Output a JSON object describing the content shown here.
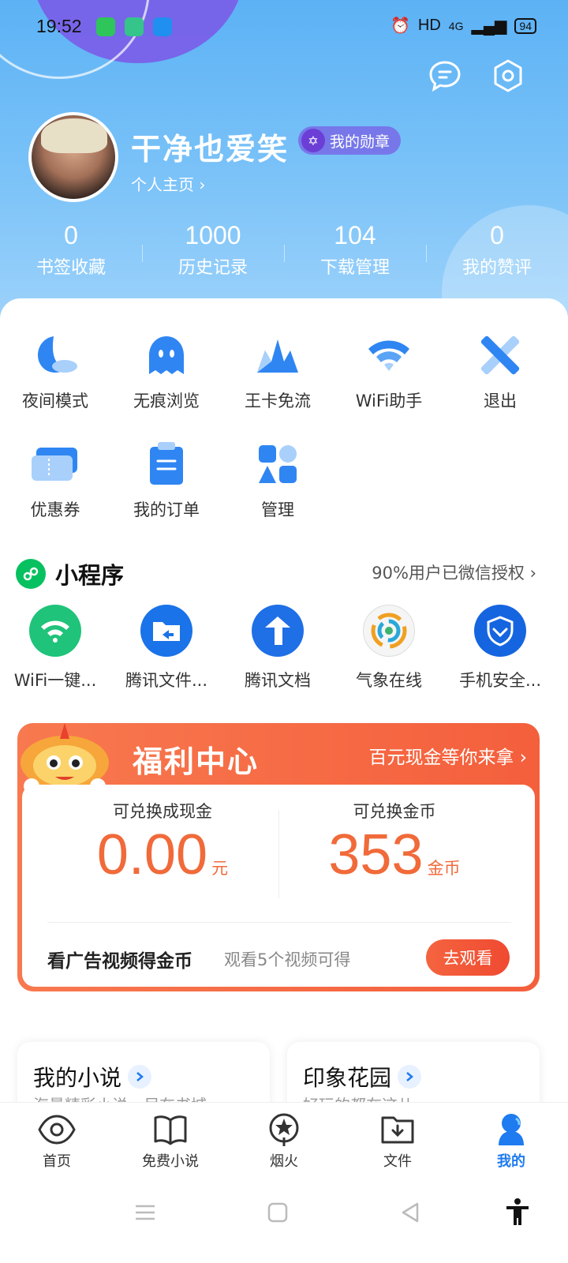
{
  "status_bar": {
    "time": "19:52",
    "network": "HD",
    "signal": "4G",
    "battery": "94"
  },
  "profile": {
    "username": "干净也爱笑",
    "medal_label": "我的勋章",
    "homepage_link": "个人主页 ›"
  },
  "stats": [
    {
      "value": "0",
      "label": "书签收藏"
    },
    {
      "value": "1000",
      "label": "历史记录"
    },
    {
      "value": "104",
      "label": "下载管理"
    },
    {
      "value": "0",
      "label": "我的赞评"
    }
  ],
  "tools": [
    {
      "label": "夜间模式",
      "icon": "moon-icon"
    },
    {
      "label": "无痕浏览",
      "icon": "ghost-icon"
    },
    {
      "label": "王卡免流",
      "icon": "crown-icon"
    },
    {
      "label": "WiFi助手",
      "icon": "wifi-icon"
    },
    {
      "label": "退出",
      "icon": "exit-icon"
    },
    {
      "label": "优惠券",
      "icon": "coupon-icon"
    },
    {
      "label": "我的订单",
      "icon": "order-icon"
    },
    {
      "label": "管理",
      "icon": "manage-icon"
    }
  ],
  "mini_programs": {
    "title": "小程序",
    "link": "90%用户已微信授权 ›",
    "items": [
      {
        "label": "WiFi一键...",
        "color": "#1fc37a"
      },
      {
        "label": "腾讯文件...",
        "color": "#1a73e8"
      },
      {
        "label": "腾讯文档",
        "color": "#1f6fe6"
      },
      {
        "label": "气象在线",
        "color": "#f0a020"
      },
      {
        "label": "手机安全...",
        "color": "#1565e0"
      }
    ]
  },
  "welfare": {
    "title": "福利中心",
    "link": "百元现金等你来拿 ›",
    "cash_label": "可兑换成现金",
    "cash_value": "0.00",
    "cash_unit": "元",
    "coin_label": "可兑换金币",
    "coin_value": "353",
    "coin_unit": "金币",
    "ad_title": "看广告视频得金币",
    "ad_sub": "观看5个视频可得",
    "watch_button": "去观看"
  },
  "cards": [
    {
      "title": "我的小说",
      "sub": "海量精彩小说，尽在书城"
    },
    {
      "title": "印象花园",
      "sub": "好玩的都在这儿"
    }
  ],
  "bottom_nav": [
    {
      "label": "首页",
      "icon": "eye-icon"
    },
    {
      "label": "免费小说",
      "icon": "book-icon"
    },
    {
      "label": "烟火",
      "icon": "firework-icon"
    },
    {
      "label": "文件",
      "icon": "folder-download-icon"
    },
    {
      "label": "我的",
      "icon": "profile-icon",
      "active": true
    }
  ],
  "colors": {
    "accent": "#1e7bf0",
    "welfare_orange": "#f16a3a",
    "hero_blue": "#6ab9f6"
  }
}
